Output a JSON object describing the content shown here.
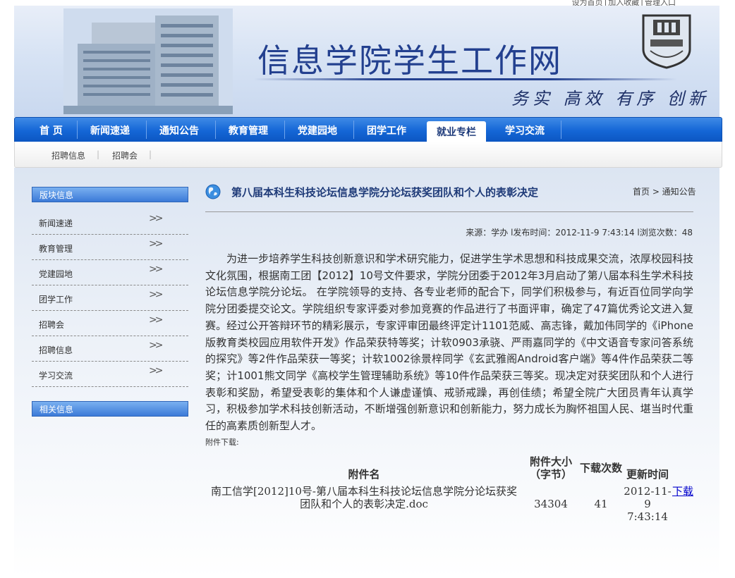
{
  "top_links": [
    "设为首页",
    "加入收藏",
    "管理入口"
  ],
  "site": {
    "title": "信息学院学生工作网",
    "motto": "务实 高效 有序 创新"
  },
  "nav": {
    "items": [
      "首 页",
      "新闻速递",
      "通知公告",
      "教育管理",
      "党建园地",
      "团学工作",
      "就业专栏",
      "学习交流"
    ],
    "active": "就业专栏"
  },
  "subnav": [
    "招聘信息",
    "招聘会"
  ],
  "sidebar": {
    "section1_title": "版块信息",
    "items": [
      "新闻速递",
      "教育管理",
      "党建园地",
      "团学工作",
      "招聘会",
      "招聘信息",
      "学习交流"
    ],
    "arrow": "》",
    "section2_title": "相关信息"
  },
  "article": {
    "title": "第八届本科生科技论坛信息学院分论坛获奖团队和个人的表彰决定",
    "breadcrumb": "首页 > 通知公告",
    "meta": "来源：学办 l发布时间：2012-11-9 7:43:14 l浏览次数：48",
    "body": "为进一步培养学生科技创新意识和学术研究能力，促进学生学术思想和科技成果交流，浓厚校园科技文化氛围，根据南工团【2012】10号文件要求，学院分团委于2012年3月启动了第八届本科生学术科技论坛信息学院分论坛。 在学院领导的支持、各专业老师的配合下，同学们积极参与，有近百位同学向学院分团委提交论文。学院组织专家评委对参加竞赛的作品进行了书面评审，确定了47篇优秀论文进入复赛。经过公开答辩环节的精彩展示，专家评审团最终评定计1101范威、高志锋，戴加伟同学的《iPhone版教育类校园应用软件开发》作品荣获特等奖；计软0903承骁、严雨嘉同学的《中文语音专家问答系统的探究》等2件作品荣获一等奖；计软1002徐景梓同学《玄武雅阁Android客户端》等4件作品荣获二等奖；计1001熊文同学《高校学生管理辅助系统》等10件作品荣获三等奖。现决定对获奖团队和个人进行表彰和奖励，希望受表彰的集体和个人谦虚谨慎、戒骄戒躁，再创佳绩；希望全院广大团员青年认真学习，积极参加学术科技创新活动，不断增强创新意识和创新能力，努力成长为胸怀祖国人民、堪当时代重任的高素质创新型人才。",
    "attachments_label": "附件下载:"
  },
  "attachments": {
    "headers": [
      "附件名",
      "附件大小（字节）",
      "下载次数",
      "更新时间",
      ""
    ],
    "rows": [
      {
        "name": "南工信学[2012]10号-第八届本科生科技论坛信息学院分论坛获奖团队和个人的表彰决定.doc",
        "size": "34304",
        "downloads": "41",
        "updated": "2012-11-9 7:43:14",
        "action": "下载"
      }
    ]
  }
}
